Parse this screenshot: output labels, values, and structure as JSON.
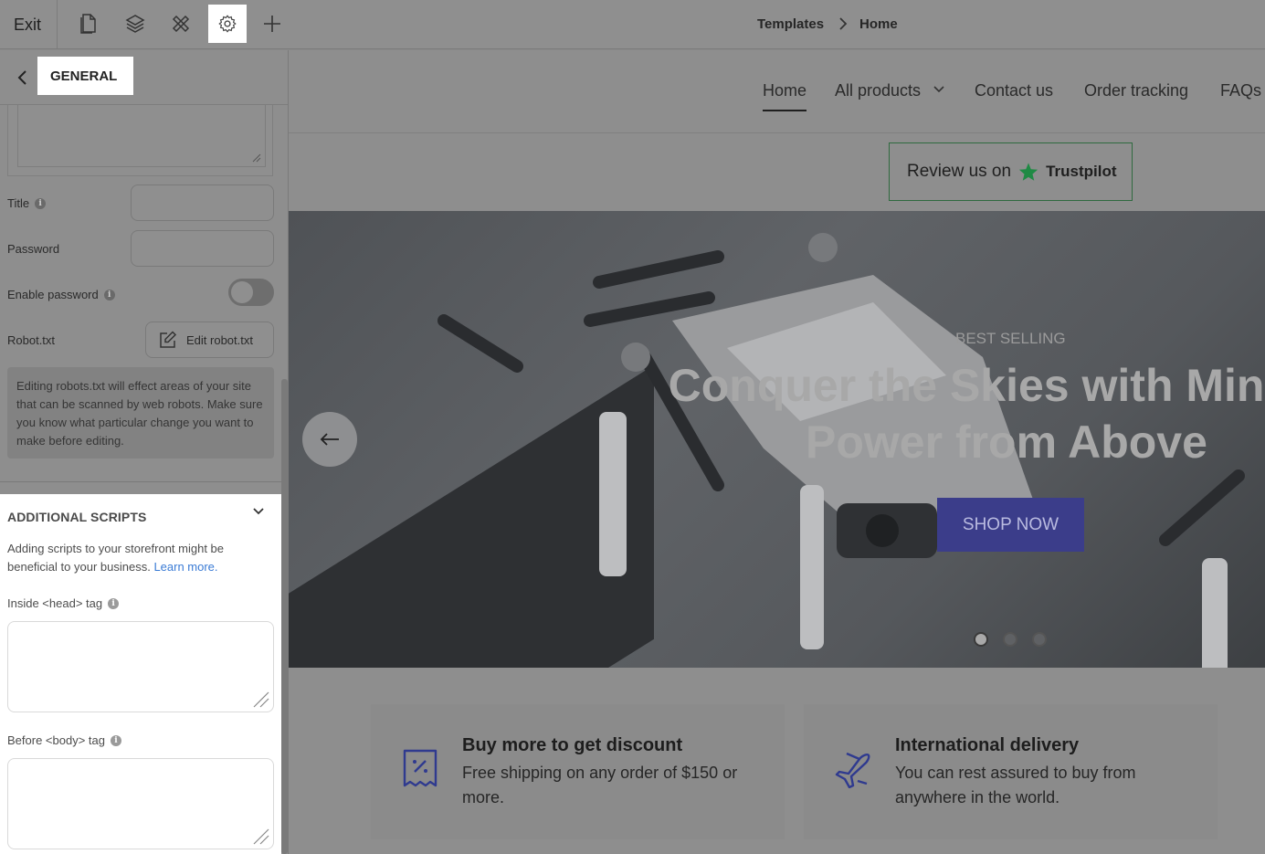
{
  "toolbar": {
    "exit_label": "Exit",
    "icons": [
      "page-icon",
      "layers-icon",
      "tools-icon",
      "gear-icon",
      "plus-icon"
    ],
    "active_icon": "gear-icon"
  },
  "breadcrumb": {
    "parent": "Templates",
    "current": "Home"
  },
  "panel": {
    "header": "GENERAL",
    "fields": {
      "title_label": "Title",
      "password_label": "Password",
      "enable_password_label": "Enable password",
      "enable_password_on": false,
      "robot_label": "Robot.txt",
      "edit_robot_button": "Edit robot.txt"
    },
    "robots_note": "Editing robots.txt will effect areas of your site that can be scanned by web robots. Make sure you know what particular change you want to make before editing.",
    "scripts": {
      "title": "ADDITIONAL SCRIPTS",
      "desc": "Adding scripts to your storefront might be beneficial to your business.",
      "learn_more": "Learn more.",
      "head_label": "Inside <head> tag",
      "body_label": "Before <body> tag",
      "head_value": "",
      "body_value": ""
    }
  },
  "store": {
    "nav": [
      "Home",
      "All products",
      "Contact us",
      "Order tracking",
      "FAQs"
    ],
    "active_nav": "Home",
    "trustpilot": {
      "prefix": "Review us on",
      "brand": "Trustpilot"
    },
    "hero": {
      "eyebrow": "BEST SELLING",
      "title_line1": "Conquer the Skies with Mini",
      "title_line2": "Power from Above",
      "cta": "SHOP NOW",
      "slide_count": 3,
      "active_slide": 1
    },
    "features": [
      {
        "title": "Buy more to get discount",
        "desc": "Free shipping on any order of $150 or more.",
        "icon": "discount-receipt-icon"
      },
      {
        "title": "International delivery",
        "desc": "You can rest assured to buy from anywhere in the world.",
        "icon": "airplane-icon"
      }
    ],
    "colors": {
      "cta": "#3b3d8a",
      "trustpilot_star": "#1f8a44",
      "feature_icon": "#2f3a8f",
      "link": "#3a7bd5"
    }
  }
}
